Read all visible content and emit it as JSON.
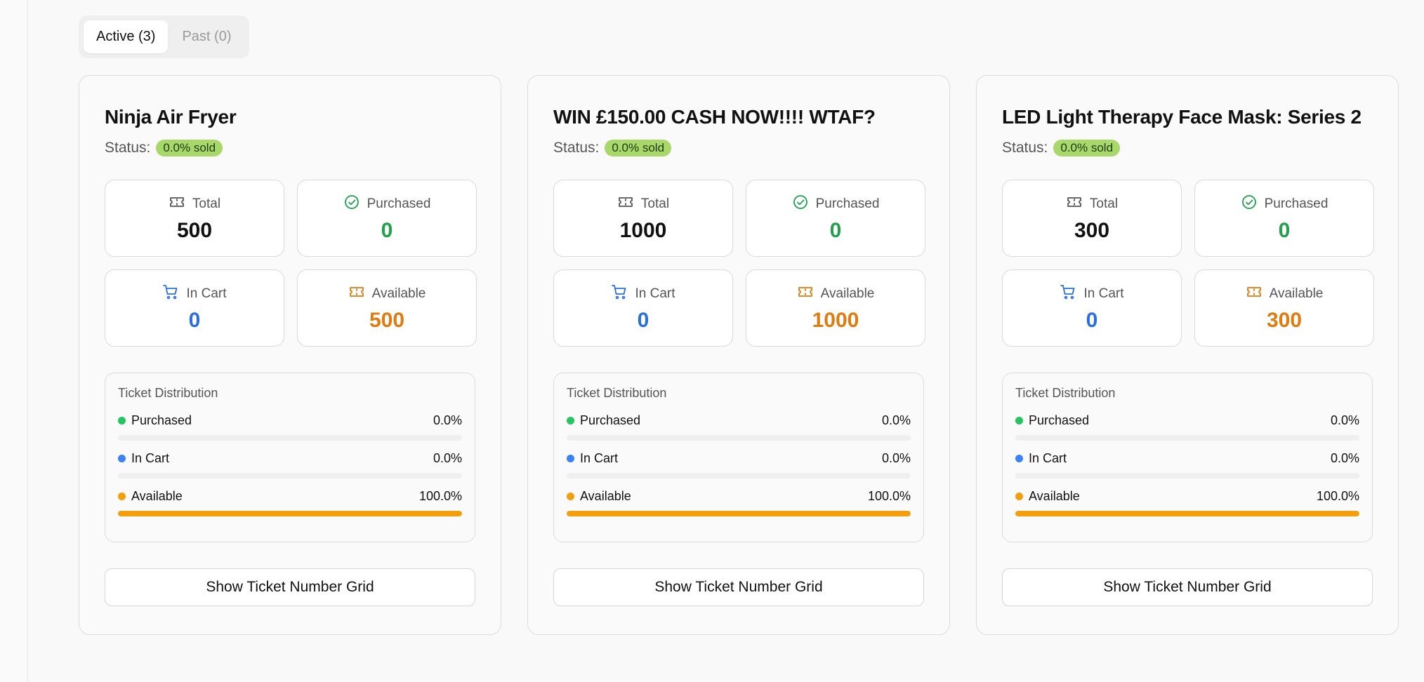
{
  "tabs": [
    {
      "label": "Active (3)",
      "active": true
    },
    {
      "label": "Past (0)",
      "active": false
    }
  ],
  "colors": {
    "purchased": "#22c55e",
    "in_cart": "#3b82f6",
    "available": "#f59e0b",
    "badge": "#a8d86a"
  },
  "icons": {
    "total": "ticket-icon",
    "purchased": "check-circle-icon",
    "in_cart": "shopping-cart-icon",
    "available": "ticket-icon"
  },
  "cards": [
    {
      "title": "Ninja Air Fryer",
      "status_label": "Status:",
      "status_badge": "0.0% sold",
      "stats": {
        "total_label": "Total",
        "total_value": "500",
        "purchased_label": "Purchased",
        "purchased_value": "0",
        "in_cart_label": "In Cart",
        "in_cart_value": "0",
        "available_label": "Available",
        "available_value": "500"
      },
      "distribution": {
        "title": "Ticket Distribution",
        "rows": [
          {
            "label": "Purchased",
            "percent_text": "0.0%",
            "fraction": 0.0
          },
          {
            "label": "In Cart",
            "percent_text": "0.0%",
            "fraction": 0.0
          },
          {
            "label": "Available",
            "percent_text": "100.0%",
            "fraction": 1.0
          }
        ]
      },
      "button_label": "Show Ticket Number Grid"
    },
    {
      "title": "WIN £150.00 CASH NOW!!!! WTAF?",
      "status_label": "Status:",
      "status_badge": "0.0% sold",
      "stats": {
        "total_label": "Total",
        "total_value": "1000",
        "purchased_label": "Purchased",
        "purchased_value": "0",
        "in_cart_label": "In Cart",
        "in_cart_value": "0",
        "available_label": "Available",
        "available_value": "1000"
      },
      "distribution": {
        "title": "Ticket Distribution",
        "rows": [
          {
            "label": "Purchased",
            "percent_text": "0.0%",
            "fraction": 0.0
          },
          {
            "label": "In Cart",
            "percent_text": "0.0%",
            "fraction": 0.0
          },
          {
            "label": "Available",
            "percent_text": "100.0%",
            "fraction": 1.0
          }
        ]
      },
      "button_label": "Show Ticket Number Grid"
    },
    {
      "title": "LED Light Therapy Face Mask: Series 2",
      "status_label": "Status:",
      "status_badge": "0.0% sold",
      "stats": {
        "total_label": "Total",
        "total_value": "300",
        "purchased_label": "Purchased",
        "purchased_value": "0",
        "in_cart_label": "In Cart",
        "in_cart_value": "0",
        "available_label": "Available",
        "available_value": "300"
      },
      "distribution": {
        "title": "Ticket Distribution",
        "rows": [
          {
            "label": "Purchased",
            "percent_text": "0.0%",
            "fraction": 0.0
          },
          {
            "label": "In Cart",
            "percent_text": "0.0%",
            "fraction": 0.0
          },
          {
            "label": "Available",
            "percent_text": "100.0%",
            "fraction": 1.0
          }
        ]
      },
      "button_label": "Show Ticket Number Grid"
    }
  ]
}
